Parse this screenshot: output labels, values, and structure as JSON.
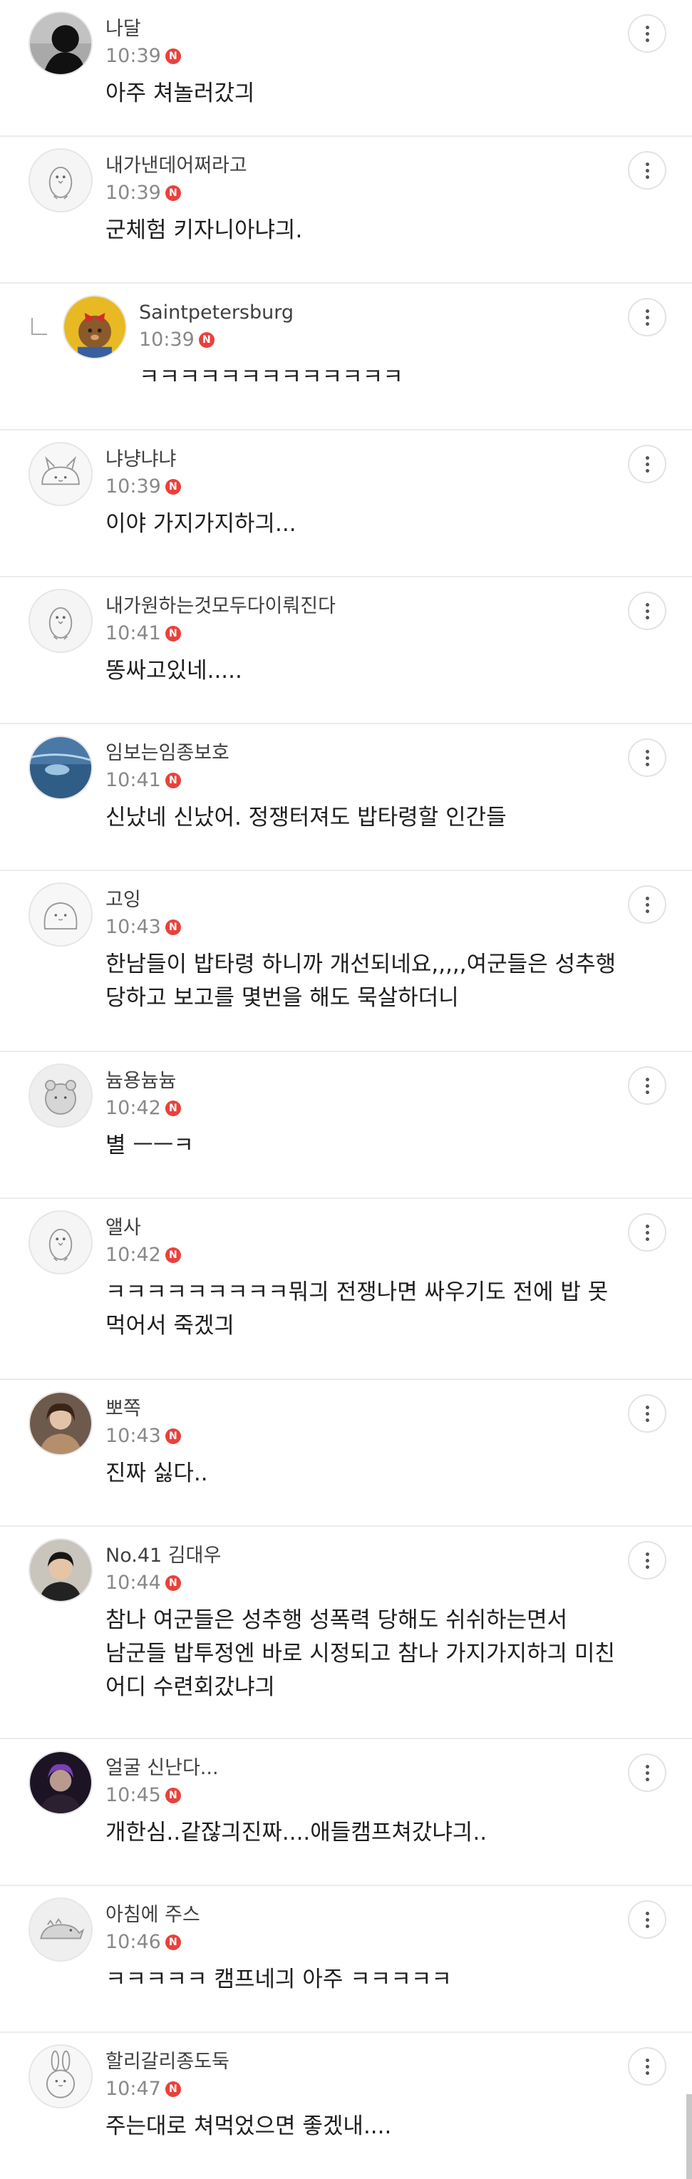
{
  "comments": [
    {
      "nick": "나달",
      "time": "10:39",
      "badge": "N",
      "text": "아주 쳐놀러갔긔",
      "avatar": "photo-dark-silhouette",
      "reply": false
    },
    {
      "nick": "내가낸데어쩌라고",
      "time": "10:39",
      "badge": "N",
      "text": "군체험 키자니아냐긔.",
      "avatar": "default-penguin",
      "reply": false
    },
    {
      "nick": "Saintpetersburg",
      "time": "10:39",
      "badge": "N",
      "text": "ㅋㅋㅋㅋㅋㅋㅋㅋㅋㅋㅋㅋㅋ",
      "avatar": "photo-bear-red-bow",
      "reply": true
    },
    {
      "nick": "냐냥냐냐",
      "time": "10:39",
      "badge": "N",
      "text": "이야 가지가지하긔...",
      "avatar": "default-cat-bun",
      "reply": false
    },
    {
      "nick": "내가원하는것모두다이뤄진다",
      "time": "10:41",
      "badge": "N",
      "text": "똥싸고있네.....",
      "avatar": "default-penguin",
      "reply": false
    },
    {
      "nick": "임보는임종보호",
      "time": "10:41",
      "badge": "N",
      "text": "신났네 신났어. 정쟁터져도 밥타령할 인간들",
      "avatar": "photo-blue-water",
      "reply": false
    },
    {
      "nick": "고잉",
      "time": "10:43",
      "badge": "N",
      "text": "한남들이 밥타령 하니까 개선되네요,,,,,여군들은 성추행\n당하고 보고를 몇번을 해도 묵살하더니",
      "avatar": "default-blob",
      "reply": false
    },
    {
      "nick": "늄용늄늄",
      "time": "10:42",
      "badge": "N",
      "text": "별 ㅡㅡㅋ",
      "avatar": "default-hamster",
      "reply": false
    },
    {
      "nick": "앨사",
      "time": "10:42",
      "badge": "N",
      "text": "ㅋㅋㅋㅋㅋㅋㅋㅋㅋ뭐긔 전쟁나면 싸우기도 전에 밥 못\n먹어서 죽겠긔",
      "avatar": "default-penguin",
      "reply": false
    },
    {
      "nick": "뽀쪽",
      "time": "10:43",
      "badge": "N",
      "text": "진짜 싫다..",
      "avatar": "photo-woman-brown-hair",
      "reply": false
    },
    {
      "nick": "No.41 김대우",
      "time": "10:44",
      "badge": "N",
      "text": "참나 여군들은 성추행 성폭력 당해도 쉬쉬하는면서\n남군들 밥투정엔 바로 시정되고 참나 가지가지하긔 미친\n어디 수련회갔냐긔",
      "avatar": "photo-man-dark-hair",
      "reply": false
    },
    {
      "nick": "얼굴 신난다...",
      "time": "10:45",
      "badge": "N",
      "text": "개한심..같잖긔진짜....애들캠프쳐갔냐긔..",
      "avatar": "photo-man-purple-light",
      "reply": false
    },
    {
      "nick": "아침에 주스",
      "time": "10:46",
      "badge": "N",
      "text": "ㅋㅋㅋㅋㅋ 캠프네긔 아주 ㅋㅋㅋㅋㅋ",
      "avatar": "default-dino",
      "reply": false
    },
    {
      "nick": "할리갈리종도둑",
      "time": "10:47",
      "badge": "N",
      "text": "주는대로 쳐먹었으면 좋겠내....",
      "avatar": "default-rabbit",
      "reply": false
    }
  ]
}
